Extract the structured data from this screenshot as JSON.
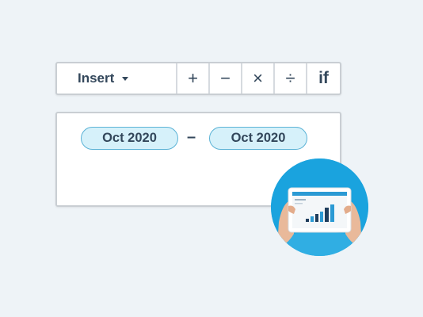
{
  "toolbar": {
    "insert_label": "Insert",
    "operators": [
      "+",
      "−",
      "×",
      "÷",
      "if"
    ]
  },
  "formula": {
    "start_date": "Oct 2020",
    "separator": "–",
    "end_date": "Oct 2020"
  },
  "colors": {
    "background": "#eef3f7",
    "text": "#33475b",
    "token_fill": "#d6f1fa",
    "token_border": "#5cb3d6",
    "photo_bg": "#1aa3de"
  }
}
